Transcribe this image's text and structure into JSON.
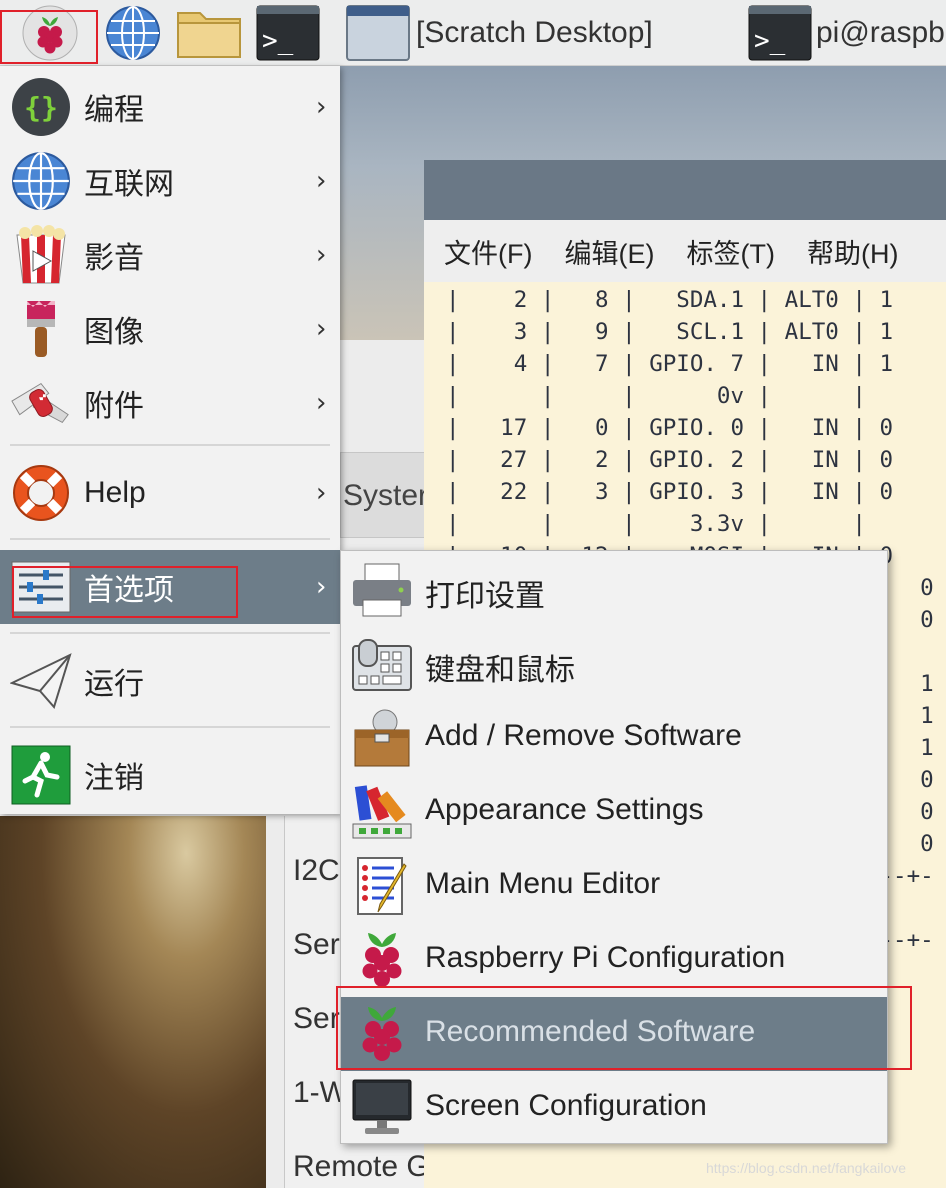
{
  "taskbar": {
    "window_buttons": [
      {
        "label": "[Scratch Desktop]",
        "icon": "scratch-window-icon"
      },
      {
        "label": "pi@raspb",
        "icon": "terminal-icon"
      }
    ]
  },
  "background_window": {
    "menus": [
      "文件(F)",
      "编辑(E)",
      "标签(T)",
      "帮助(H)"
    ],
    "terminal_text": "|    2 |   8 |   SDA.1 | ALT0 | 1\n|    3 |   9 |   SCL.1 | ALT0 | 1\n|    4 |   7 | GPIO. 7 |   IN | 1\n|      |     |      0v |      |\n|   17 |   0 | GPIO. 0 |   IN | 0\n|   27 |   2 | GPIO. 2 |   IN | 0\n|   22 |   3 | GPIO. 3 |   IN | 0\n|      |     |    3.3v |      |\n|   10 |  12 |    MOSI |   IN | 0\n                                   0\n                                   0\n\n                                   1\n                                   1\n                                   1\n                                   0\n                                   0\n                                   0\n             +-----+------+---+---+-\n                           e | V\n             +-----+------+---+---+-\n                      y\n                       n He\n                       SSOLU\n                      anty\nRaspberry Pi Details:"
  },
  "config_panel": {
    "tab_partial": "Syster",
    "rows": [
      "I2C",
      "Ser",
      "Ser",
      "1-W",
      "Remote G"
    ]
  },
  "main_menu": {
    "items": [
      {
        "label": "编程",
        "icon": "programming-braces-icon",
        "has_submenu": true
      },
      {
        "label": "互联网",
        "icon": "globe-icon",
        "has_submenu": true
      },
      {
        "label": "影音",
        "icon": "popcorn-video-icon",
        "has_submenu": true
      },
      {
        "label": "图像",
        "icon": "paintbrush-icon",
        "has_submenu": true
      },
      {
        "label": "附件",
        "icon": "swiss-knife-icon",
        "has_submenu": true
      },
      {
        "label": "Help",
        "icon": "lifebuoy-icon",
        "has_submenu": true
      },
      {
        "label": "首选项",
        "icon": "preferences-sliders-icon",
        "has_submenu": true,
        "selected": true
      },
      {
        "label": "运行",
        "icon": "paper-plane-icon",
        "has_submenu": false
      },
      {
        "label": "注销",
        "icon": "exit-running-man-icon",
        "has_submenu": false
      }
    ],
    "arrow_glyph": "›"
  },
  "submenu": {
    "items": [
      {
        "label": "打印设置",
        "icon": "printer-icon"
      },
      {
        "label": "键盘和鼠标",
        "icon": "keyboard-mouse-icon"
      },
      {
        "label": "Add / Remove Software",
        "icon": "software-box-icon"
      },
      {
        "label": "Appearance Settings",
        "icon": "color-palette-icon"
      },
      {
        "label": "Main Menu Editor",
        "icon": "menu-editor-icon"
      },
      {
        "label": "Raspberry Pi Configuration",
        "icon": "raspberry-icon"
      },
      {
        "label": "Recommended Software",
        "icon": "raspberry-icon",
        "selected": true
      },
      {
        "label": "Screen Configuration",
        "icon": "monitor-icon"
      }
    ]
  },
  "watermark": "https://blog.csdn.net/fangkailove",
  "colors": {
    "menu_bg": "#f2f2f2",
    "selected_bg": "#6d7d89",
    "highlight_box": "#e0202a",
    "terminal_bg": "#fbf3d9"
  }
}
